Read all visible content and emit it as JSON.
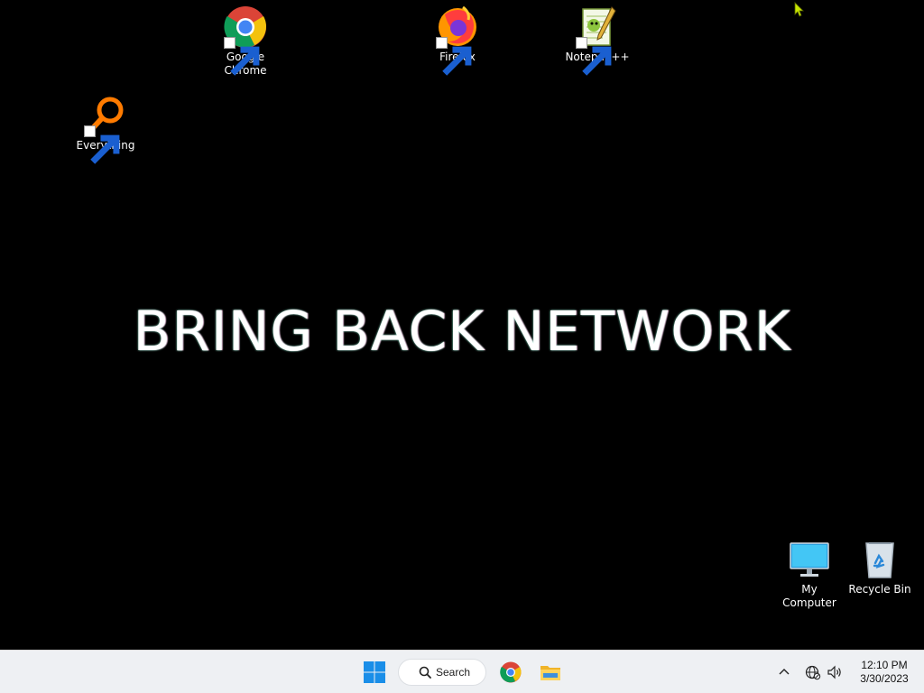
{
  "wallpaper": {
    "text": "BRING BACK NETWORK"
  },
  "desktop_icons": [
    {
      "label": "Google\nChrome",
      "icon": "chrome-icon"
    },
    {
      "label": "Firefox",
      "icon": "firefox-icon"
    },
    {
      "label": "Notepad++",
      "icon": "notepadpp-icon"
    },
    {
      "label": "Everything",
      "icon": "everything-search-icon"
    },
    {
      "label": "My Computer",
      "icon": "monitor-icon"
    },
    {
      "label": "Recycle Bin",
      "icon": "recycle-bin-icon"
    }
  ],
  "taskbar": {
    "search_label": "Search",
    "clock_time": "12:10 PM",
    "clock_date": "3/30/2023",
    "pinned": [
      "start-icon",
      "chrome-icon",
      "file-explorer-icon"
    ],
    "tray": [
      "chevron-up-icon",
      "network-globe-icon",
      "volume-icon"
    ]
  },
  "colors": {
    "taskbar_bg": "#eef0f3",
    "desktop_bg": "#000000",
    "cursor": "#c8e600"
  }
}
